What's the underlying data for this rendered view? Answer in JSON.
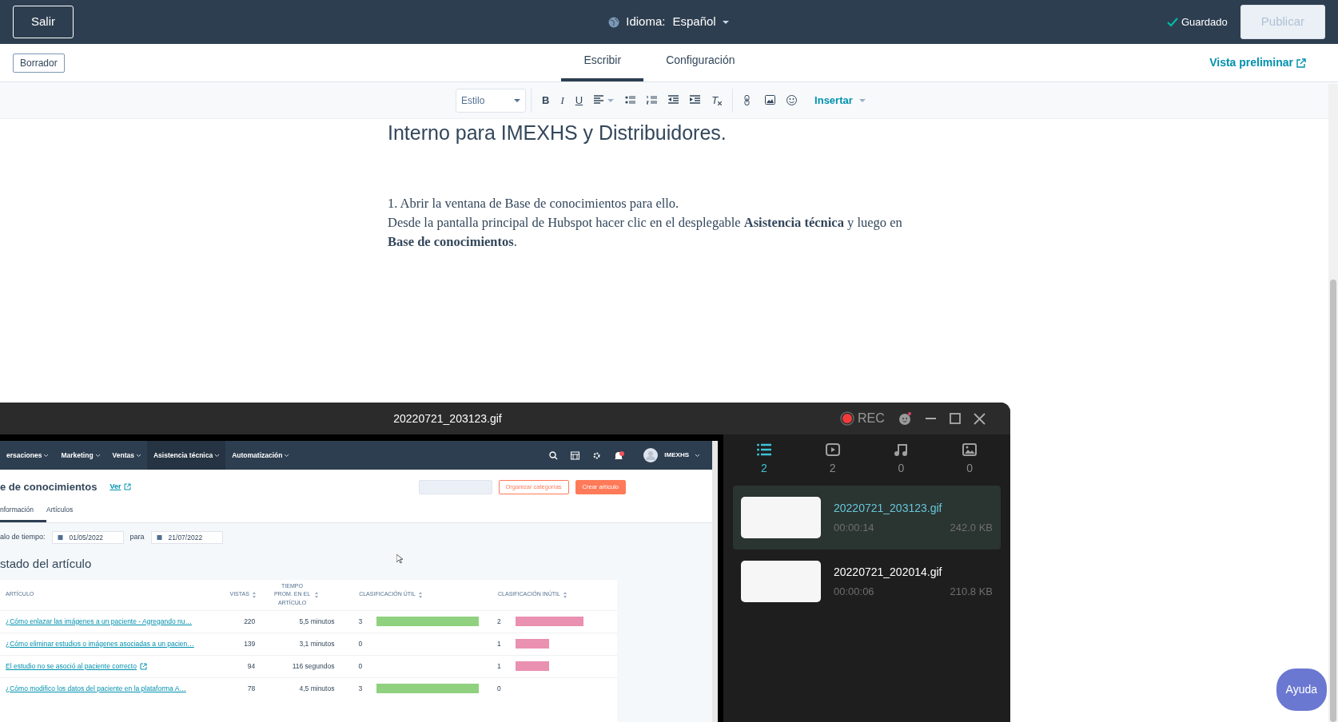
{
  "top_bar": {
    "exit_button": "Salir",
    "language_label": "Idioma:",
    "language": "Español",
    "save_status": "Guardado",
    "publish_button": {
      "label": "Publicar",
      "disabled": true
    }
  },
  "sub_bar": {
    "status_badge": "Borrador",
    "tabs": [
      {
        "label": "Escribir",
        "selected": true
      },
      {
        "label": "Configuración",
        "selected": false
      }
    ],
    "preview_link": "Vista preliminar"
  },
  "toolbar": {
    "style_select": "Estilo",
    "tools": [
      {
        "kind": "bold",
        "glyph": "B"
      },
      {
        "kind": "italic",
        "glyph": "I"
      },
      {
        "kind": "underline",
        "glyph": "U"
      },
      {
        "kind": "align"
      },
      {
        "kind": "bullets"
      },
      {
        "kind": "numbered"
      },
      {
        "kind": "outdent"
      },
      {
        "kind": "indent"
      },
      {
        "kind": "clear",
        "glyph": "T"
      },
      {
        "kind": "sep"
      },
      {
        "kind": "link"
      },
      {
        "kind": "image"
      },
      {
        "kind": "emoji"
      }
    ],
    "insert_menu": "Insertar"
  },
  "editor": {
    "heading": "Interno para IMEXHS y Distribuidores.",
    "paragraphs": [
      "1. Abrir la ventana de Base de conocimientos para ello.",
      "Desde la pantalla principal de Hubspot hacer clic en el desplegable **Asistencia técnica** y luego en **Base de conocimientos**."
    ]
  },
  "recorder": {
    "title": "20220721_203123.gif",
    "rec_label": "REC",
    "tabs": [
      {
        "kind": "list",
        "count": "2",
        "selected": true
      },
      {
        "kind": "video",
        "count": "2",
        "selected": false
      },
      {
        "kind": "audio",
        "count": "0",
        "selected": false
      },
      {
        "kind": "image",
        "count": "0",
        "selected": false
      }
    ],
    "files": [
      {
        "name": "20220721_203123.gif",
        "duration": "00:00:14",
        "size": "242.0 KB",
        "selected": true
      },
      {
        "name": "20220721_202014.gif",
        "duration": "00:00:06",
        "size": "210.8 KB",
        "selected": false
      }
    ],
    "preview": {
      "nav": [
        {
          "label": "ersaciones",
          "selected": false
        },
        {
          "label": "Marketing",
          "selected": false
        },
        {
          "label": "Ventas",
          "selected": false
        },
        {
          "label": "Asistencia técnica",
          "selected": true
        },
        {
          "label": "Automatización",
          "selected": false
        }
      ],
      "account": "IMEXHS",
      "page_title": "e de conocimientos",
      "view_link": "Ver",
      "buttons": [
        {
          "kind": "disabled"
        },
        {
          "kind": "outline",
          "label": "Organizar categorías"
        },
        {
          "kind": "primary",
          "label": "Crear artículo"
        }
      ],
      "tabs": [
        {
          "label": "nformación",
          "selected": true
        },
        {
          "label": "Artículos",
          "selected": false
        }
      ],
      "date_range": {
        "label": "alo de tiempo:",
        "from": "01/05/2022",
        "joiner": "para",
        "to": "21/07/2022"
      },
      "section_title": "stado del artículo",
      "table": {
        "columns": [
          "ARTÍCULO",
          "VISTAS",
          "TIEMPO PROM. EN EL ARTÍCULO",
          "CLASIFICACIÓN ÚTIL",
          "CLASIFICACIÓN INÚTIL"
        ],
        "rows": [
          {
            "article": "¿Cómo enlazar las imágenes a un paciente - Agregando nu…",
            "external": false,
            "views": "220",
            "time": "5,5 minutos",
            "useful": {
              "count": "3"
            },
            "useless": {
              "count": "2"
            }
          },
          {
            "article": "¿Cómo eliminar estudios o imágenes asociadas a un pacien…",
            "external": false,
            "views": "139",
            "time": "3,1 minutos",
            "useful": {
              "count": "0"
            },
            "useless": {
              "count": "1"
            }
          },
          {
            "article": "El estudio no se asoció al paciente correcto",
            "external": true,
            "views": "94",
            "time": "116 segundos",
            "useful": {
              "count": "0"
            },
            "useless": {
              "count": "1"
            }
          },
          {
            "article": "¿Cómo modifico los datos del paciente en la plataforma A…",
            "external": false,
            "views": "78",
            "time": "4,5 minutos",
            "useful": {
              "count": "3"
            },
            "useless": {
              "count": "0"
            }
          }
        ]
      }
    }
  },
  "help_button": "Ayuda"
}
